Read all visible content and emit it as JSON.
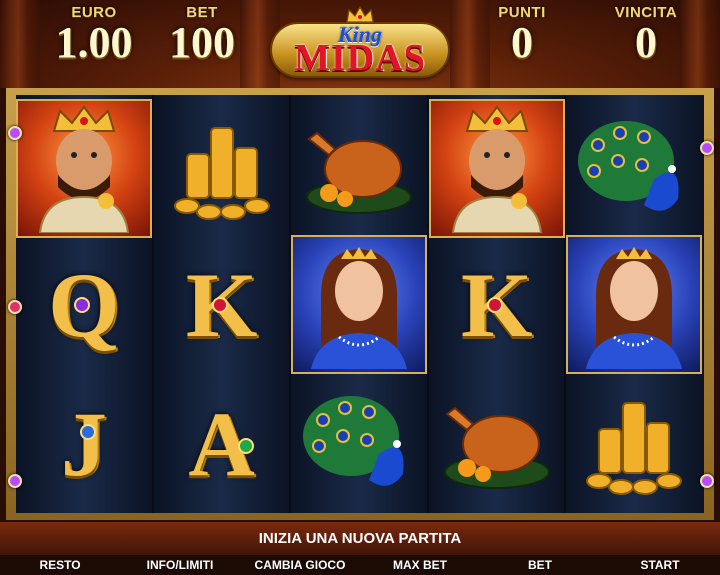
{
  "header": {
    "euro_label": "EURO",
    "euro_value": "1.00",
    "bet_label": "BET",
    "bet_value": "100",
    "punti_label": "PUNTI",
    "punti_value": "0",
    "vincita_label": "VINCITA",
    "vincita_value": "0"
  },
  "logo": {
    "line1": "King",
    "line2": "MIDAS"
  },
  "reels": [
    [
      "king",
      "Q",
      "J"
    ],
    [
      "coins",
      "K",
      "A"
    ],
    [
      "turkey",
      "queen",
      "peacock"
    ],
    [
      "king",
      "K",
      "turkey"
    ],
    [
      "peacock",
      "queen",
      "coins"
    ]
  ],
  "message": "INIZIA UNA NUOVA PARTITA",
  "buttons": [
    "RESTO",
    "INFO/LIMITI",
    "CAMBIA GIOCO",
    "MAX BET",
    "BET",
    "START"
  ],
  "colors": {
    "gold": "#f2c04a",
    "logo_red": "#e3142a",
    "logo_blue": "#1d4fd8"
  }
}
